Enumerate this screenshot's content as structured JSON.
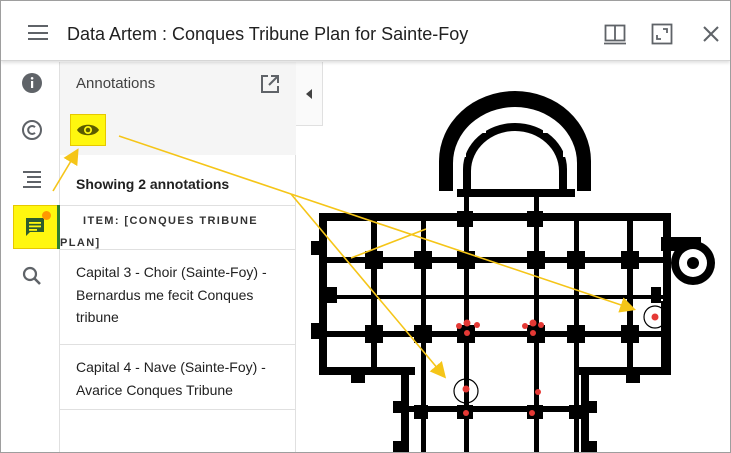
{
  "header": {
    "title": "Data Artem : Conques Tribune Plan for Sainte-Foy"
  },
  "icons": {
    "menu": "hamburger-icon",
    "split_view": "book-open-icon",
    "fullscreen": "fullscreen-icon",
    "close": "close-icon",
    "info": "info-icon",
    "rights": "copyright-icon",
    "index": "list-icon",
    "annotations": "comment-icon",
    "search": "search-icon",
    "popout": "open-in-new-icon",
    "visibility": "eye-icon",
    "collapse": "chevron-left-icon"
  },
  "panel": {
    "title": "Annotations",
    "showing": "Showing 2 annotations",
    "item_heading": "ITEM: [CONQUES TRIBUNE PLAN]",
    "annotations": [
      {
        "label": "Capital 3 - Choir (Sainte-Foy) - Bernardus me fecit Conques tribune"
      },
      {
        "label": "Capital 4 - Nave (Sainte-Foy) - Avarice Conques Tribune"
      }
    ]
  },
  "colors": {
    "highlight": "#fff70f",
    "arrow": "#f5c518",
    "annotation_marker": "#e53935",
    "active_bar": "#2e7d32",
    "badge": "#ff9800"
  }
}
